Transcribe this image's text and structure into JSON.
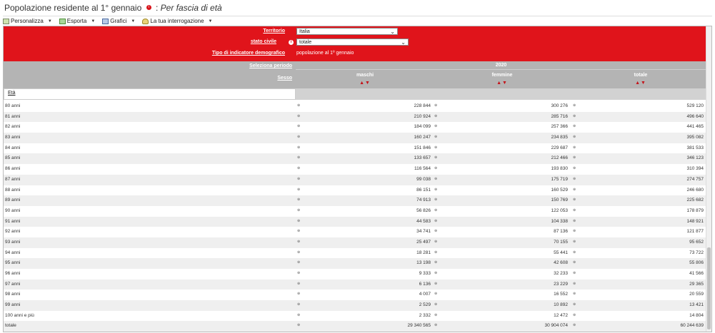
{
  "title": {
    "main": "Popolazione residente al 1° gennaio",
    "info_icon": "info-icon",
    "separator": ":",
    "subtitle": "Per fascia di età"
  },
  "toolbar": [
    {
      "label": "Personalizza",
      "icon": "customize-icon"
    },
    {
      "label": "Esporta",
      "icon": "export-icon"
    },
    {
      "label": "Grafici",
      "icon": "chart-icon"
    },
    {
      "label": "La tua interrogazione",
      "icon": "user-icon"
    }
  ],
  "filters": {
    "territorio_label": "Territorio",
    "territorio_value": "Italia",
    "stato_civile_label": "stato civile",
    "stato_civile_value": "totale",
    "tipo_label": "Tipo di indicatore demografico",
    "tipo_value": "popolazione al 1º gennaio"
  },
  "header": {
    "selezione_label": "Seleziona periodo",
    "year": "2020",
    "sesso_label": "Sesso",
    "columns": [
      "maschi",
      "femmine",
      "totale"
    ],
    "eta_label": "Età"
  },
  "colors": {
    "accent_red": "#e0141b",
    "header_gray": "#b4b4b4"
  },
  "rows": [
    {
      "age": "80 anni",
      "maschi": "228 844",
      "femmine": "300 276",
      "totale": "529 120"
    },
    {
      "age": "81 anni",
      "maschi": "210 924",
      "femmine": "285 716",
      "totale": "496 640"
    },
    {
      "age": "82 anni",
      "maschi": "184 099",
      "femmine": "257 366",
      "totale": "441 465"
    },
    {
      "age": "83 anni",
      "maschi": "160 247",
      "femmine": "234 835",
      "totale": "395 082"
    },
    {
      "age": "84 anni",
      "maschi": "151 846",
      "femmine": "229 687",
      "totale": "381 533"
    },
    {
      "age": "85 anni",
      "maschi": "133 657",
      "femmine": "212 466",
      "totale": "346 123"
    },
    {
      "age": "86 anni",
      "maschi": "116 564",
      "femmine": "193 830",
      "totale": "310 394"
    },
    {
      "age": "87 anni",
      "maschi": "99 038",
      "femmine": "175 719",
      "totale": "274 757"
    },
    {
      "age": "88 anni",
      "maschi": "86 151",
      "femmine": "160 529",
      "totale": "246 680"
    },
    {
      "age": "89 anni",
      "maschi": "74 913",
      "femmine": "150 769",
      "totale": "225 682"
    },
    {
      "age": "90 anni",
      "maschi": "56 826",
      "femmine": "122 053",
      "totale": "178 879"
    },
    {
      "age": "91 anni",
      "maschi": "44 583",
      "femmine": "104 338",
      "totale": "148 921"
    },
    {
      "age": "92 anni",
      "maschi": "34 741",
      "femmine": "87 136",
      "totale": "121 877"
    },
    {
      "age": "93 anni",
      "maschi": "25 497",
      "femmine": "70 155",
      "totale": "95 652"
    },
    {
      "age": "94 anni",
      "maschi": "18 281",
      "femmine": "55 441",
      "totale": "73 722"
    },
    {
      "age": "95 anni",
      "maschi": "13 198",
      "femmine": "42 608",
      "totale": "55 806"
    },
    {
      "age": "96 anni",
      "maschi": "9 333",
      "femmine": "32 233",
      "totale": "41 566"
    },
    {
      "age": "97 anni",
      "maschi": "6 136",
      "femmine": "23 229",
      "totale": "29 365"
    },
    {
      "age": "98 anni",
      "maschi": "4 007",
      "femmine": "16 552",
      "totale": "20 559"
    },
    {
      "age": "99 anni",
      "maschi": "2 529",
      "femmine": "10 892",
      "totale": "13 421"
    },
    {
      "age": "100 anni e più",
      "maschi": "2 332",
      "femmine": "12 472",
      "totale": "14 804"
    },
    {
      "age": "totale",
      "maschi": "29 340 565",
      "femmine": "30 904 074",
      "totale": "60 244 639"
    }
  ]
}
